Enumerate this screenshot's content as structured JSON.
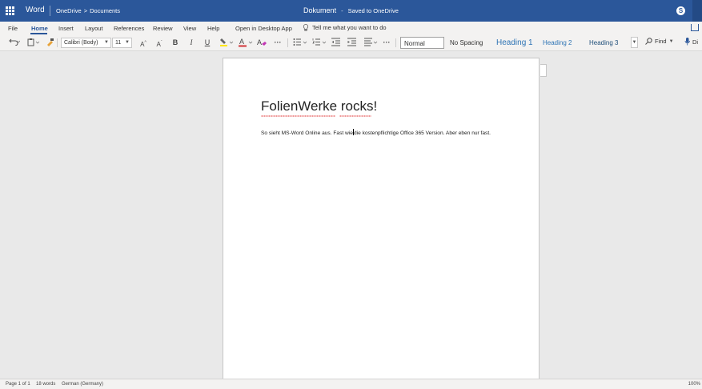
{
  "titlebar": {
    "app_name": "Word",
    "breadcrumb": [
      "OneDrive",
      "Documents"
    ],
    "breadcrumb_separator": ">",
    "document_name": "Dokument",
    "separator": "-",
    "save_status": "Saved to OneDrive",
    "accent_color": "#2b579a",
    "skype_icon": "S"
  },
  "ribbon": {
    "tabs": [
      "File",
      "Home",
      "Insert",
      "Layout",
      "References",
      "Review",
      "View",
      "Help",
      "Open in Desktop App"
    ],
    "active_tab": "Home",
    "tell_me_placeholder": "Tell me what you want to do"
  },
  "toolbar": {
    "font_family": "Calibri (Body)",
    "font_size": "11",
    "bold": "B",
    "italic": "I",
    "underline": "U",
    "highlight_color": "#ffe600",
    "font_color": "#d13438",
    "styles": [
      "Normal",
      "No Spacing",
      "Heading 1",
      "Heading 2",
      "Heading 3"
    ],
    "selected_style": "Normal",
    "find_label": "Find",
    "dictate_label": "Di"
  },
  "document": {
    "heading": "FolienWerke rocks!",
    "body_before_caret": "So sieht MS-Word Online aus. Fast wie",
    "body_after_caret": "die kostenpflichtige Office 365 Version. Aber eben nur fast."
  },
  "statusbar": {
    "page": "Page 1 of 1",
    "words": "18 words",
    "language": "German (Germany)",
    "zoom": "100%"
  }
}
